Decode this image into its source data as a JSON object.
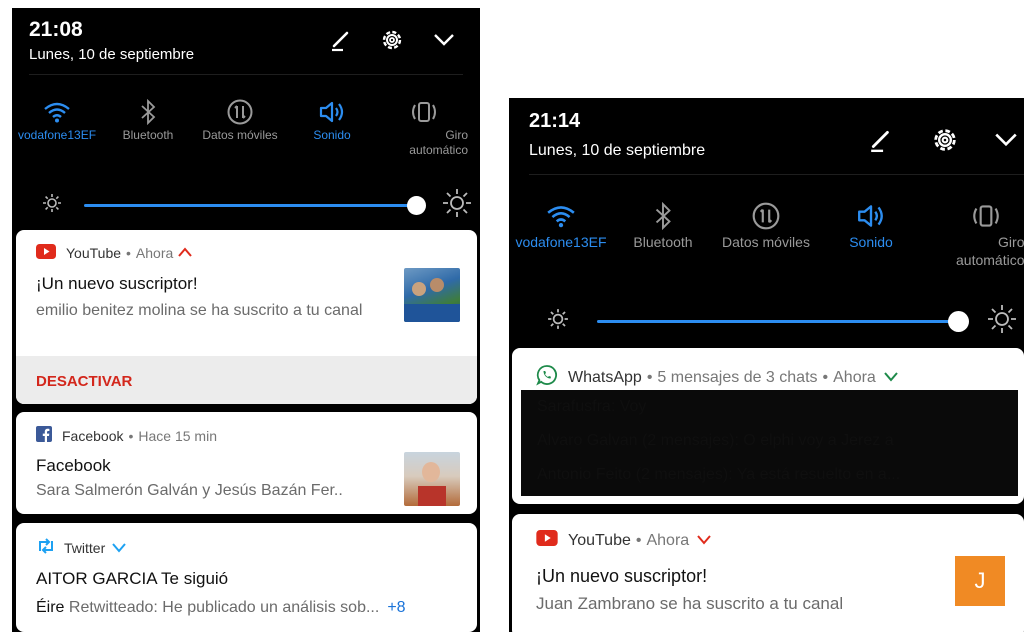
{
  "left": {
    "status": {
      "time": "21:08",
      "date": "Lunes, 10 de septiembre"
    },
    "quick_settings": [
      {
        "label": "vodafone13EF",
        "icon": "wifi-icon",
        "active": true
      },
      {
        "label": "Bluetooth",
        "icon": "bluetooth-icon",
        "active": false
      },
      {
        "label": "Datos móviles",
        "icon": "mobile-data-icon",
        "active": false
      },
      {
        "label": "Sonido",
        "icon": "sound-icon",
        "active": true
      },
      {
        "label": "Giro automático",
        "icon": "auto-rotate-icon",
        "active": false
      }
    ],
    "brightness": 1.0,
    "notifications": {
      "youtube": {
        "app": "YouTube",
        "time": "Ahora",
        "title": "¡Un nuevo suscriptor!",
        "body": "emilio benitez molina se ha suscrito a tu canal",
        "action": "DESACTIVAR"
      },
      "facebook": {
        "app": "Facebook",
        "time": "Hace 15 min",
        "title": "Facebook",
        "body": "Sara Salmerón Galván y Jesús Bazán Fer.."
      },
      "twitter": {
        "app": "Twitter",
        "title_name": "AITOR GARCIA",
        "title_rest": "Te siguió",
        "body_name": "Éire",
        "body_rest": "Retwitteado: He publicado un análisis sob...",
        "more": "+8"
      }
    }
  },
  "right": {
    "status": {
      "time": "21:14",
      "date": "Lunes, 10 de septiembre"
    },
    "quick_settings": [
      {
        "label": "vodafone13EF",
        "icon": "wifi-icon",
        "active": true
      },
      {
        "label": "Bluetooth",
        "icon": "bluetooth-icon",
        "active": false
      },
      {
        "label": "Datos móviles",
        "icon": "mobile-data-icon",
        "active": false
      },
      {
        "label": "Sonido",
        "icon": "sound-icon",
        "active": true
      },
      {
        "label": "Giro automático",
        "icon": "auto-rotate-icon",
        "active": false
      }
    ],
    "brightness": 1.0,
    "notifications": {
      "whatsapp": {
        "app": "WhatsApp",
        "summary": "5 mensajes de 3 chats",
        "time": "Ahora",
        "lines": [
          "Sarafusfra: Voy",
          "Alvaro Galvan (2 mensajes): O elphi voy a Jerez a",
          "Antonio Feito (2 mensajes): Ya está resuelto en a..."
        ]
      },
      "youtube": {
        "app": "YouTube",
        "time": "Ahora",
        "title": "¡Un nuevo suscriptor!",
        "body": "Juan Zambrano se ha suscrito a tu canal",
        "avatar_letter": "J"
      }
    }
  },
  "colors": {
    "accent": "#2c8df0",
    "youtube_red": "#e02b1c",
    "facebook_blue": "#3b5998",
    "twitter_blue": "#1da1f2",
    "whatsapp_green": "#1e8a4a",
    "avatar_orange": "#f08a24",
    "action_red": "#d3271c"
  }
}
